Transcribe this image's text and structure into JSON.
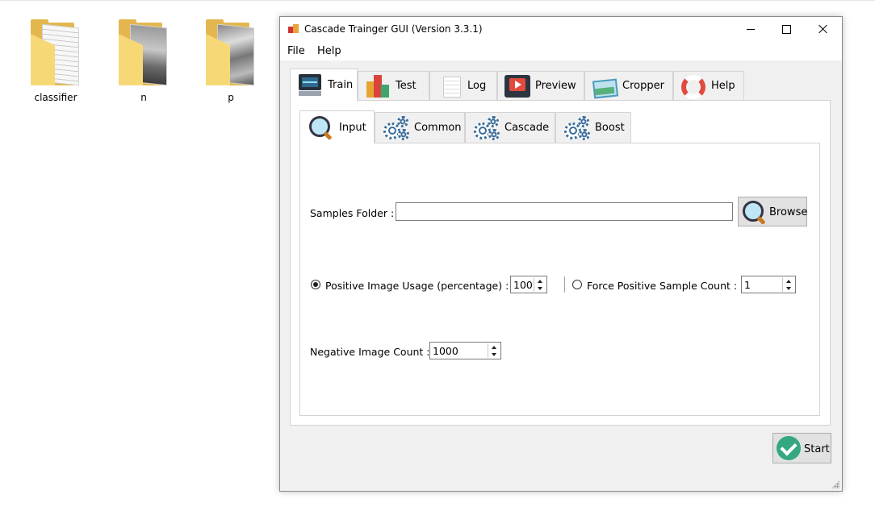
{
  "desktop": {
    "icons": [
      {
        "label": "classifier"
      },
      {
        "label": "n"
      },
      {
        "label": "p"
      }
    ]
  },
  "window": {
    "title": "Cascade Trainger GUI (Version 3.3.1)"
  },
  "menu": {
    "file": "File",
    "help": "Help"
  },
  "outer_tabs": {
    "train": "Train",
    "test": "Test",
    "log": "Log",
    "preview": "Preview",
    "cropper": "Cropper",
    "help": "Help"
  },
  "inner_tabs": {
    "input": "Input",
    "common": "Common",
    "cascade": "Cascade",
    "boost": "Boost"
  },
  "form": {
    "samples_folder_label": "Samples Folder :",
    "samples_folder_value": "",
    "browse_label": "Browse",
    "positive_usage_label": "Positive Image Usage (percentage) :",
    "positive_usage_value": "100",
    "positive_usage_selected": true,
    "force_positive_label": "Force Positive Sample Count :",
    "force_positive_value": "1",
    "force_positive_selected": false,
    "negative_count_label": "Negative Image Count :",
    "negative_count_value": "1000"
  },
  "actions": {
    "start_label": "Start"
  },
  "icons": {
    "train": "monitor-waveform-icon",
    "test": "bar-chart-icon",
    "log": "document-icon",
    "preview": "video-play-icon",
    "cropper": "picture-icon",
    "help": "lifebuoy-icon",
    "input": "magnifier-icon",
    "common": "gears-icon",
    "cascade": "gears-icon",
    "boost": "gears-icon",
    "browse": "magnifier-icon",
    "start": "check-circle-icon"
  }
}
